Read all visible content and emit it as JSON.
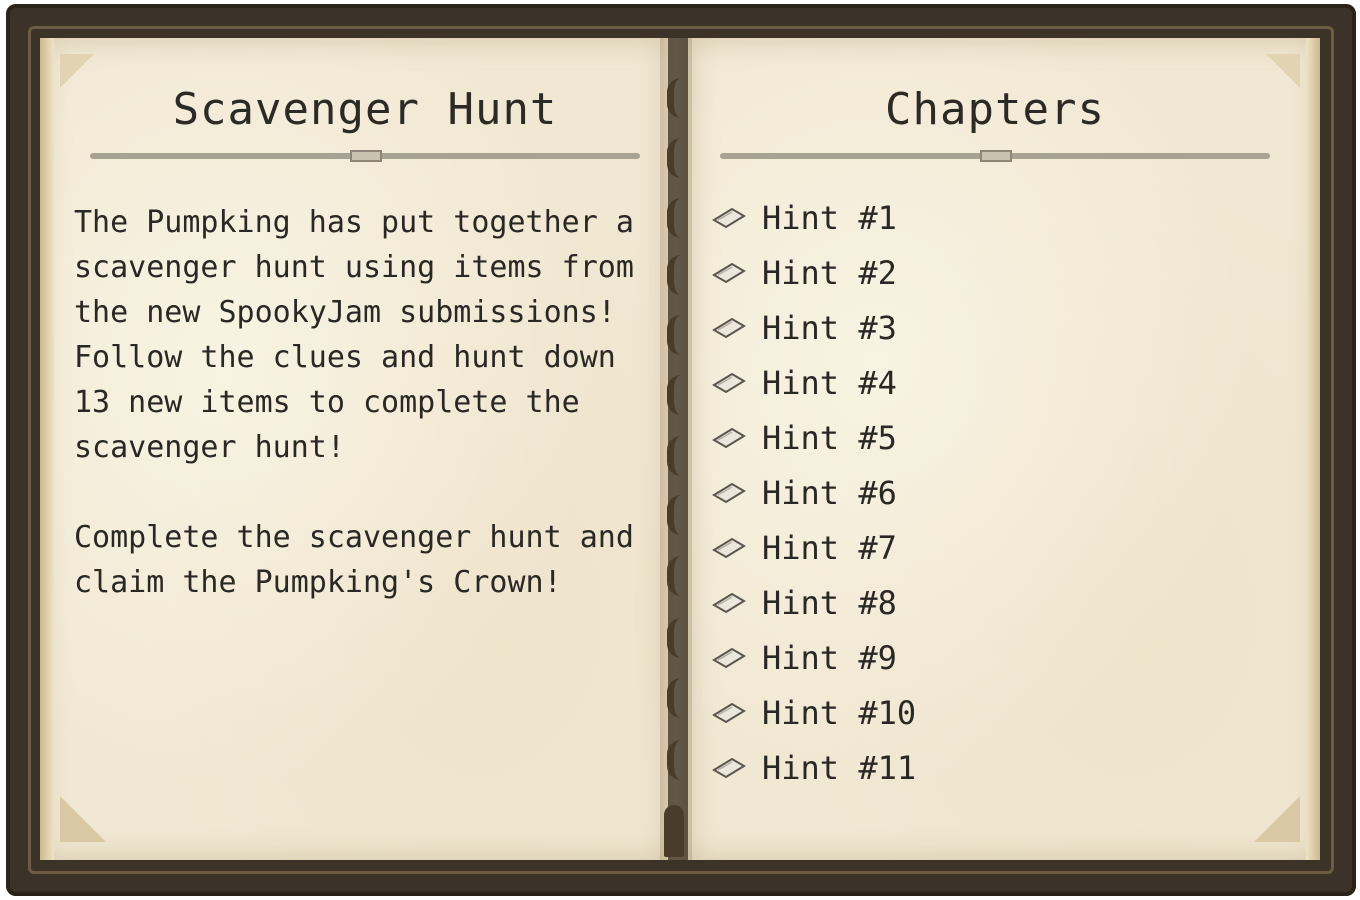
{
  "left_page": {
    "title": "Scavenger Hunt",
    "paragraphs": [
      "The Pumpking has put together a scavenger hunt using items from the new SpookyJam submissions! Follow the clues and hunt down 13 new items to complete the scavenger hunt!",
      "Complete the scavenger hunt and claim the Pumpking's Crown!"
    ]
  },
  "right_page": {
    "title": "Chapters",
    "chapters": [
      {
        "label": "Hint #1",
        "icon": "paper-icon"
      },
      {
        "label": "Hint #2",
        "icon": "paper-icon"
      },
      {
        "label": "Hint #3",
        "icon": "paper-icon"
      },
      {
        "label": "Hint #4",
        "icon": "paper-icon"
      },
      {
        "label": "Hint #5",
        "icon": "paper-icon"
      },
      {
        "label": "Hint #6",
        "icon": "paper-icon"
      },
      {
        "label": "Hint #7",
        "icon": "paper-icon"
      },
      {
        "label": "Hint #8",
        "icon": "paper-icon"
      },
      {
        "label": "Hint #9",
        "icon": "paper-icon"
      },
      {
        "label": "Hint #10",
        "icon": "paper-icon"
      },
      {
        "label": "Hint #11",
        "icon": "paper-icon"
      }
    ]
  },
  "colors": {
    "frame": "#3b3327",
    "paper": "#f1e8d3",
    "text": "#2a2824",
    "divider": "#a8a295"
  }
}
